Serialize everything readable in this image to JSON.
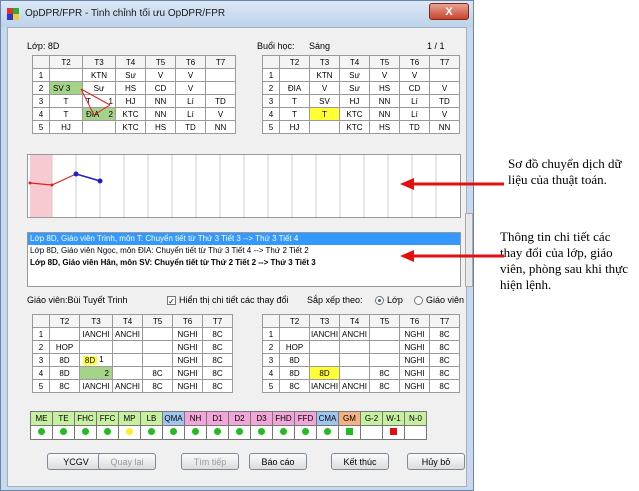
{
  "window": {
    "title": "OpDPR/FPR - Tinh chỉnh tối ưu OpDPR/FPR",
    "close": "X"
  },
  "top": {
    "class_label": "Lớp: 8D",
    "session_label": "Buổi học:",
    "session_value": "Sáng",
    "page": "1 / 1",
    "headers": [
      "T2",
      "T3",
      "T4",
      "T5",
      "T6",
      "T7"
    ],
    "left_rows": [
      [
        "1",
        "",
        "KTN",
        "Sư",
        "V",
        "V"
      ],
      [
        "2",
        "SV",
        "3",
        "Sư",
        "HS",
        "CD",
        "V"
      ],
      [
        "3",
        "T",
        "T",
        "1",
        "HJ",
        "NN",
        "Lí",
        "TD"
      ],
      [
        "4",
        "T",
        "ĐIA",
        "2",
        "KTC",
        "NN",
        "Lí",
        "V"
      ],
      [
        "5",
        "HJ",
        "",
        "KTC",
        "HS",
        "TD",
        "NN",
        "SH"
      ]
    ],
    "right_rows": [
      [
        "1",
        "",
        "KTN",
        "Sư",
        "V",
        "V"
      ],
      [
        "2",
        "ĐIA",
        "V",
        "Sư",
        "HS",
        "CD",
        "V"
      ],
      [
        "3",
        "T",
        "SV",
        "HJ",
        "NN",
        "Lí",
        "TD"
      ],
      [
        "4",
        "T",
        "T",
        "KTC",
        "NN",
        "Lí",
        "V"
      ],
      [
        "5",
        "HJ",
        "",
        "KTC",
        "HS",
        "TD",
        "NN",
        "SH"
      ]
    ]
  },
  "log": [
    "Lớp 8D, Giáo viên Trinh, môn T: Chuyển tiết từ Thứ 3 Tiết 3 --> Thứ 3 Tiết 4",
    "Lớp 8D, Giáo viên Ngọc, môn ĐIA: Chuyển tiết từ Thứ 3 Tiết 4 --> Thứ 2 Tiết 2",
    "Lớp 8D, Giáo viên Hân, môn SV: Chuyển tiết từ Thứ 2 Tiết 2 --> Thứ 3 Tiết 3"
  ],
  "options": {
    "teacher_label": "Giáo viên:Bùi Tuyết Trinh",
    "show_detail": "Hiển thị chi tiết các thay đổi",
    "sort_label": "Sắp xếp theo:",
    "sort_class": "Lớp",
    "sort_teacher": "Giáo viên"
  },
  "bottom": {
    "headers": [
      "T2",
      "T3",
      "T4",
      "T5",
      "T6",
      "T7"
    ]
  },
  "legend": {
    "labels": [
      "ME",
      "TE",
      "FHC",
      "FFC",
      "MP",
      "LB",
      "QMA",
      "NH",
      "D1",
      "D2",
      "D3",
      "FHD",
      "FFD",
      "CMA",
      "GM",
      "G-2",
      "W-1",
      "N-0"
    ],
    "colors": [
      "#c6efa0",
      "#c6efa0",
      "#c6efa0",
      "#c6efa0",
      "#c6efa0",
      "#c6efa0",
      "#9fc6ee",
      "#f0a6d6",
      "#f0a6d6",
      "#f0a6d6",
      "#f0a6d6",
      "#f0a6d6",
      "#f0a6d6",
      "#9fc6ee",
      "#f4b183",
      "#c6efa0",
      "#c6efa0",
      "#c6efa0"
    ]
  },
  "buttons": {
    "ycgv": "YCGV",
    "back": "Quay lại",
    "next": "Tìm tiếp",
    "report": "Báo cáo",
    "finish": "Kết thúc",
    "cancel": "Hủy bỏ"
  },
  "annotations": {
    "diagram_note": "Sơ đồ chuyển dịch dữ liệu của thuật toán.",
    "log_note": "Thông tin chi tiết các thay đổi của lớp, giáo viên, phòng sau khi thực hiện lệnh."
  }
}
